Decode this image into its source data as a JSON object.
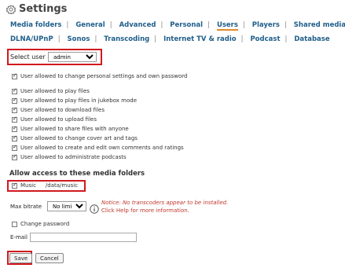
{
  "header": {
    "title": "Settings",
    "icon": "gear-icon"
  },
  "nav_row1": [
    "Media folders",
    "General",
    "Advanced",
    "Personal",
    "Users",
    "Players",
    "Shared media"
  ],
  "nav_row2": [
    "DLNA/UPnP",
    "Sonos",
    "Transcoding",
    "Internet TV & radio",
    "Podcast",
    "Database"
  ],
  "active_tab": "Users",
  "select_user": {
    "label": "Select user",
    "value": "admin"
  },
  "permissions": [
    {
      "label": "User allowed to change personal settings and own password",
      "checked": true
    },
    {
      "label": "User allowed to play files",
      "checked": true
    },
    {
      "label": "User allowed to play files in jukebox mode",
      "checked": true
    },
    {
      "label": "User allowed to download files",
      "checked": true
    },
    {
      "label": "User allowed to upload files",
      "checked": true
    },
    {
      "label": "User allowed to share files with anyone",
      "checked": true
    },
    {
      "label": "User allowed to change cover art and tags",
      "checked": true
    },
    {
      "label": "User allowed to create and edit own comments and ratings",
      "checked": true
    },
    {
      "label": "User allowed to administrate podcasts",
      "checked": true
    }
  ],
  "media_section": {
    "heading": "Allow access to these media folders",
    "folder": {
      "name": "Music",
      "path": "/data/music",
      "checked": true
    }
  },
  "max_bitrate": {
    "label": "Max bitrate",
    "value": "No limit"
  },
  "notice": {
    "line1": "Notice: No transcoders appear to be installed.",
    "line2": "Click Help for more information."
  },
  "change_password": {
    "label": "Change password",
    "checked": false
  },
  "email": {
    "label": "E-mail",
    "value": ""
  },
  "buttons": {
    "save": "Save",
    "cancel": "Cancel"
  },
  "colors": {
    "link": "#1f5e8a",
    "highlight_box": "#d1191f",
    "active_underline": "#e08a2c",
    "notice": "#c0392b"
  }
}
